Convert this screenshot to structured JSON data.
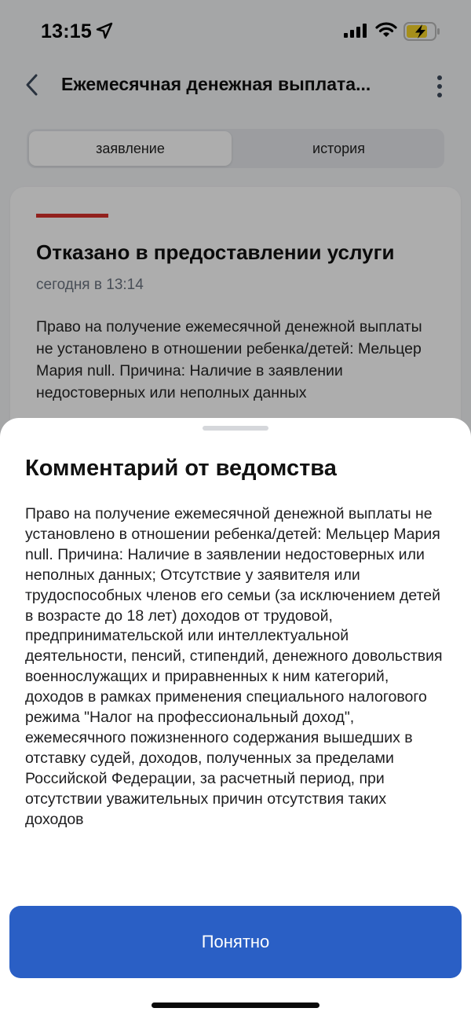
{
  "status_bar": {
    "time": "13:15"
  },
  "header": {
    "title": "Ежемесячная денежная выплата..."
  },
  "tabs": [
    {
      "label": "заявление",
      "active": true
    },
    {
      "label": "история",
      "active": false
    }
  ],
  "card": {
    "title": "Отказано в предоставлении услуги",
    "time": "сегодня в 13:14",
    "text": "Право на получение ежемесячной денежной выплаты не установлено в отношении ребенка/детей: Мельцер Мария null. Причина: Наличие в заявлении недостоверных или неполных данных"
  },
  "sheet": {
    "title": "Комментарий от ведомства",
    "text": "Право на получение ежемесячной денежной выплаты не установлено в отношении ребенка/детей: Мельцер Мария null. Причина: Наличие в заявлении недостоверных или неполных данных; Отсутствие у заявителя или трудоспособных членов его семьи (за исключением детей в возрасте до 18 лет) доходов от трудовой, предпринимательской или интеллектуальной деятельности, пенсий, стипендий, денежного довольствия военнослужащих и приравненных к ним категорий, доходов в рамках применения специального налогового режима \"Налог на профессиональный доход\", ежемесячного пожизненного содержания вышедших в отставку судей, доходов, полученных за пределами Российской Федерации, за расчетный период, при отсутствии уважительных причин отсутствия таких доходов",
    "button_label": "Понятно"
  },
  "colors": {
    "accent": "#2a5fc5",
    "status_rejected": "#d8312b"
  },
  "icons": {
    "location": "navigation-arrow-icon",
    "signal": "cellular-signal-icon",
    "wifi": "wifi-icon",
    "battery": "battery-charging-icon",
    "back": "chevron-left-icon",
    "menu": "more-vertical-icon"
  }
}
